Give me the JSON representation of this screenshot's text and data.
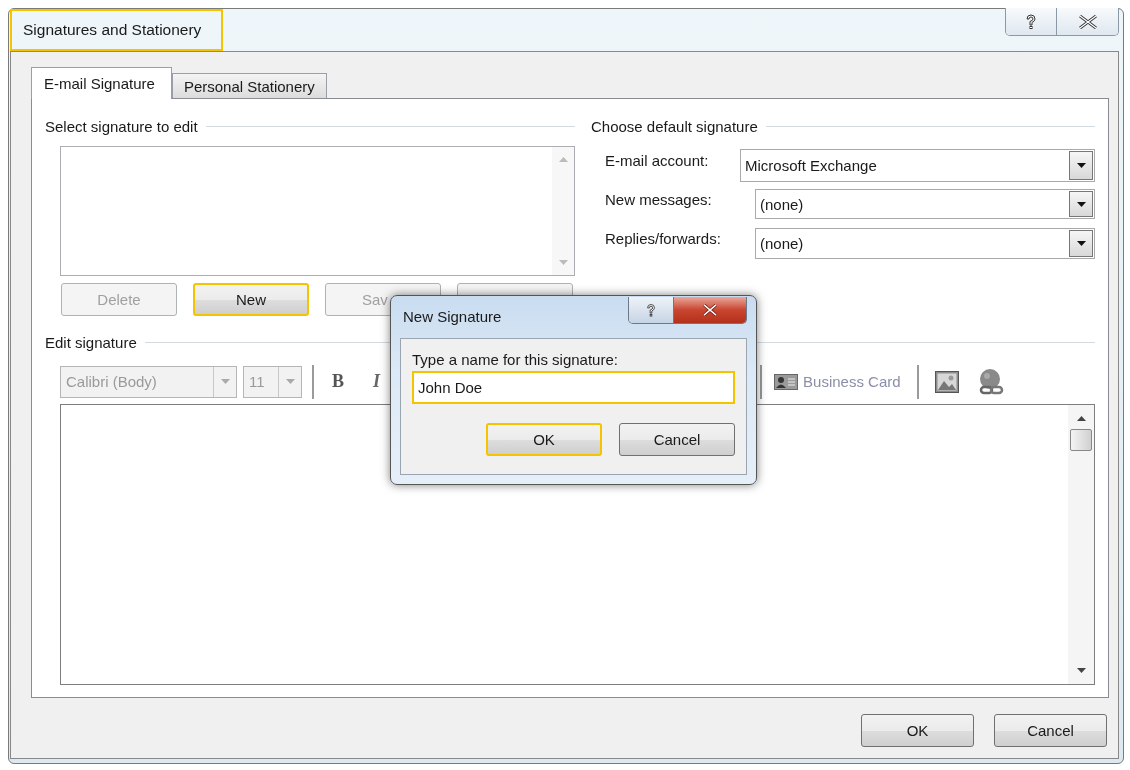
{
  "window": {
    "title": "Signatures and Stationery",
    "highlighted": true
  },
  "tabs": [
    {
      "label": "E-mail Signature",
      "selected": true
    },
    {
      "label": "Personal Stationery",
      "selected": false
    }
  ],
  "select_signature": {
    "heading": "Select signature to edit",
    "buttons": [
      {
        "label": "Delete",
        "disabled": true,
        "highlighted": false
      },
      {
        "label": "New",
        "disabled": false,
        "highlighted": true
      },
      {
        "label": "Sav",
        "disabled": true,
        "highlighted": false
      },
      {
        "disabled": true,
        "highlighted": false
      }
    ]
  },
  "default_signature": {
    "heading": "Choose default signature",
    "fields": [
      {
        "label": "E-mail account:",
        "value": "Microsoft Exchange"
      },
      {
        "label": "New messages:",
        "value": "(none)"
      },
      {
        "label": "Replies/forwards:",
        "value": "(none)"
      }
    ]
  },
  "edit_signature": {
    "heading": "Edit signature",
    "disabled": true,
    "toolbar": [
      {
        "kind": "combo",
        "value": "Calibri (Body)"
      },
      {
        "kind": "size",
        "value": "11"
      },
      {
        "kind": "separator"
      },
      {
        "kind": "bold",
        "label": "B"
      },
      {
        "kind": "italic",
        "label": "I"
      },
      {
        "kind": "separator"
      },
      {
        "kind": "business-card",
        "label": "Business Card"
      },
      {
        "kind": "separator"
      },
      {
        "kind": "picture"
      },
      {
        "kind": "hyperlink"
      }
    ]
  },
  "buttons": [
    {
      "label": "OK"
    },
    {
      "label": "Cancel"
    }
  ],
  "new_signature_dialog": {
    "title": "New Signature",
    "prompt": "Type a name for this signature:",
    "name": {
      "value": "John Doe",
      "highlighted": true
    },
    "buttons": [
      {
        "label": "OK",
        "highlighted": true
      },
      {
        "label": "Cancel",
        "highlighted": false
      }
    ]
  }
}
